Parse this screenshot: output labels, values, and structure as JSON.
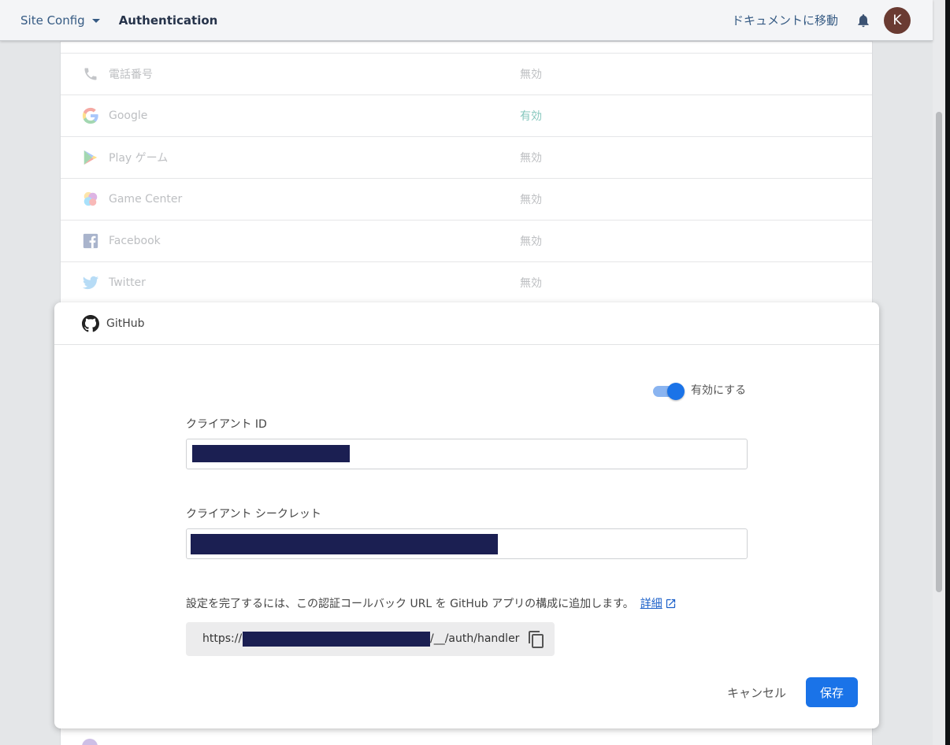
{
  "topbar": {
    "project_label": "Site Config",
    "section_title": "Authentication",
    "docs_link": "ドキュメントに移動",
    "avatar_initial": "K"
  },
  "providers": [
    {
      "icon": "phone-icon",
      "name": "電話番号",
      "status": "無効"
    },
    {
      "icon": "google-icon",
      "name": "Google",
      "status": "有効"
    },
    {
      "icon": "play-games-icon",
      "name": "Play ゲーム",
      "status": "無効"
    },
    {
      "icon": "game-center-icon",
      "name": "Game Center",
      "status": "無効"
    },
    {
      "icon": "facebook-icon",
      "name": "Facebook",
      "status": "無効"
    },
    {
      "icon": "twitter-icon",
      "name": "Twitter",
      "status": "無効"
    }
  ],
  "dialog": {
    "provider_name": "GitHub",
    "enable_label": "有効にする",
    "enabled": true,
    "client_id_label": "クライアント ID",
    "client_secret_label": "クライアント シークレット",
    "info_text": "設定を完了するには、この認証コールバック URL を GitHub アプリの構成に追加します。",
    "details_link": "詳細",
    "callback_url_prefix": "https://",
    "callback_url_suffix": "/__/auth/handler",
    "cancel_label": "キャンセル",
    "save_label": "保存"
  },
  "colors": {
    "primary": "#1a73e8",
    "enabled_status": "#86c7bd",
    "redaction": "#1b1f52",
    "avatar": "#6a3b32"
  }
}
